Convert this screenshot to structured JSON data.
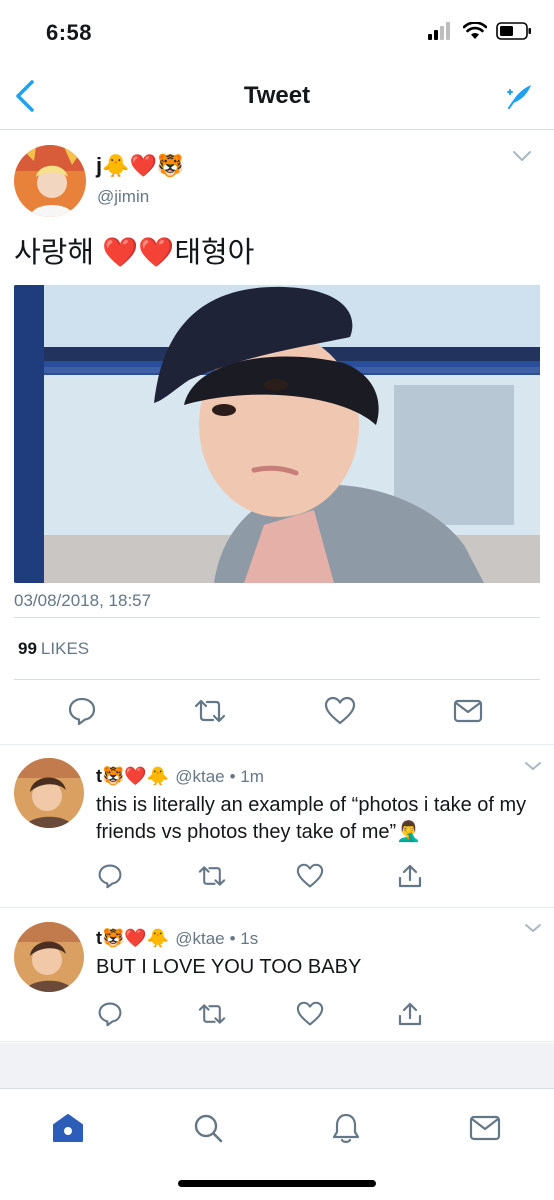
{
  "status_bar": {
    "time": "6:58"
  },
  "nav": {
    "title": "Tweet"
  },
  "main_tweet": {
    "name": "j🐥❤️🐯",
    "handle": "@jimin",
    "text": "사랑해 ❤️❤️태형아",
    "date": "03/08/2018, 18:57",
    "likes_count": "99",
    "likes_label": "LIKES"
  },
  "replies": [
    {
      "name": "t🐯❤️🐥",
      "handle": "@ktae",
      "time": "• 1m",
      "text": "this is literally an example of “photos i take of my friends vs photos they take of me”🤦‍♂️"
    },
    {
      "name": "t🐯❤️🐥",
      "handle": "@ktae",
      "time": "• 1s",
      "text": "BUT I LOVE YOU TOO BABY"
    }
  ],
  "colors": {
    "accent": "#1da1f2",
    "nav_blue": "#2c5db8",
    "icon_gray": "#657786"
  },
  "icons": [
    "back-icon",
    "compose-icon",
    "chevron-down-icon",
    "reply-icon",
    "retweet-icon",
    "like-icon",
    "message-icon",
    "share-icon",
    "home-icon",
    "search-icon",
    "notifications-icon"
  ]
}
